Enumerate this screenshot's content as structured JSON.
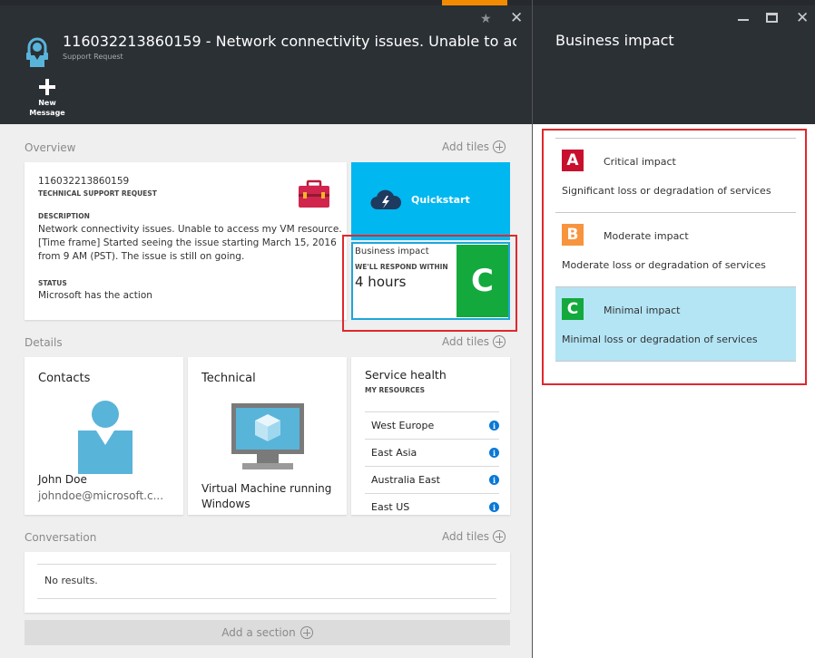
{
  "ticket": {
    "title": "116032213860159 - Network connectivity issues. Unable to acc...",
    "subtitle": "Support Request",
    "new_message_label": "New Message"
  },
  "sections": {
    "overview": "Overview",
    "details": "Details",
    "conversation": "Conversation",
    "add_tiles": "Add tiles",
    "add_section": "Add a section"
  },
  "overview": {
    "id": "116032213860159",
    "type": "TECHNICAL SUPPORT REQUEST",
    "description_heading": "DESCRIPTION",
    "description": "Network connectivity issues. Unable to access my VM resource. [Time frame] Started seeing the issue starting March 15, 2016 from 9 AM (PST). The issue is still on going.",
    "status_heading": "STATUS",
    "status": "Microsoft has the action"
  },
  "quickstart": {
    "label": "Quickstart"
  },
  "business_impact_tile": {
    "title": "Business impact",
    "respond_label": "WE'LL RESPOND WITHIN",
    "respond_value": "4 hours",
    "badge": "C"
  },
  "contacts": {
    "title": "Contacts",
    "name": "John Doe",
    "email": "johndoe@microsoft.c..."
  },
  "technical": {
    "title": "Technical",
    "label": "Virtual Machine running Windows"
  },
  "service_health": {
    "title": "Service health",
    "subtitle": "MY RESOURCES",
    "regions": [
      "West Europe",
      "East Asia",
      "Australia East",
      "East US"
    ]
  },
  "conversation": {
    "empty": "No results."
  },
  "right_blade": {
    "title": "Business impact",
    "options": [
      {
        "badge": "A",
        "title": "Critical impact",
        "desc": "Significant loss or degradation of services",
        "color": "#c8102e"
      },
      {
        "badge": "B",
        "title": "Moderate impact",
        "desc": "Moderate loss or degradation of services",
        "color": "#f7943d"
      },
      {
        "badge": "C",
        "title": "Minimal impact",
        "desc": "Minimal loss or degradation of services",
        "color": "#13a93d"
      }
    ]
  },
  "colors": {
    "header_bg": "#2b3035",
    "accent_orange": "#f38b00",
    "quickstart_blue": "#00b7f0",
    "highlight_red": "#e0282d",
    "selected_row": "#b3e5f5"
  }
}
